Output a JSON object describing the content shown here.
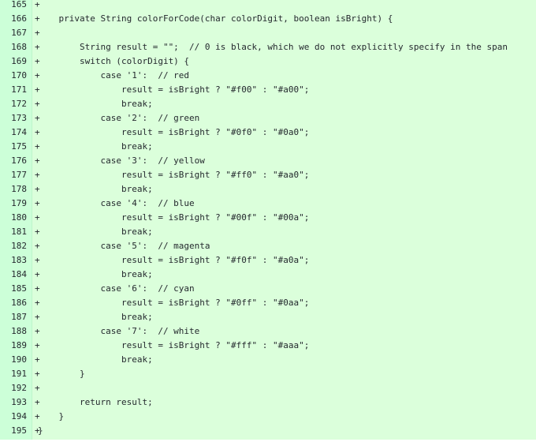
{
  "diff": {
    "lines": [
      {
        "num": "165",
        "sign": "+",
        "text": ""
      },
      {
        "num": "166",
        "sign": "+",
        "text": "    private String colorForCode(char colorDigit, boolean isBright) {"
      },
      {
        "num": "167",
        "sign": "+",
        "text": ""
      },
      {
        "num": "168",
        "sign": "+",
        "text": "        String result = \"\";  // 0 is black, which we do not explicitly specify in the span"
      },
      {
        "num": "169",
        "sign": "+",
        "text": "        switch (colorDigit) {"
      },
      {
        "num": "170",
        "sign": "+",
        "text": "            case '1':  // red"
      },
      {
        "num": "171",
        "sign": "+",
        "text": "                result = isBright ? \"#f00\" : \"#a00\";"
      },
      {
        "num": "172",
        "sign": "+",
        "text": "                break;"
      },
      {
        "num": "173",
        "sign": "+",
        "text": "            case '2':  // green"
      },
      {
        "num": "174",
        "sign": "+",
        "text": "                result = isBright ? \"#0f0\" : \"#0a0\";"
      },
      {
        "num": "175",
        "sign": "+",
        "text": "                break;"
      },
      {
        "num": "176",
        "sign": "+",
        "text": "            case '3':  // yellow"
      },
      {
        "num": "177",
        "sign": "+",
        "text": "                result = isBright ? \"#ff0\" : \"#aa0\";"
      },
      {
        "num": "178",
        "sign": "+",
        "text": "                break;"
      },
      {
        "num": "179",
        "sign": "+",
        "text": "            case '4':  // blue"
      },
      {
        "num": "180",
        "sign": "+",
        "text": "                result = isBright ? \"#00f\" : \"#00a\";"
      },
      {
        "num": "181",
        "sign": "+",
        "text": "                break;"
      },
      {
        "num": "182",
        "sign": "+",
        "text": "            case '5':  // magenta"
      },
      {
        "num": "183",
        "sign": "+",
        "text": "                result = isBright ? \"#f0f\" : \"#a0a\";"
      },
      {
        "num": "184",
        "sign": "+",
        "text": "                break;"
      },
      {
        "num": "185",
        "sign": "+",
        "text": "            case '6':  // cyan"
      },
      {
        "num": "186",
        "sign": "+",
        "text": "                result = isBright ? \"#0ff\" : \"#0aa\";"
      },
      {
        "num": "187",
        "sign": "+",
        "text": "                break;"
      },
      {
        "num": "188",
        "sign": "+",
        "text": "            case '7':  // white"
      },
      {
        "num": "189",
        "sign": "+",
        "text": "                result = isBright ? \"#fff\" : \"#aaa\";"
      },
      {
        "num": "190",
        "sign": "+",
        "text": "                break;"
      },
      {
        "num": "191",
        "sign": "+",
        "text": "        }"
      },
      {
        "num": "192",
        "sign": "+",
        "text": ""
      },
      {
        "num": "193",
        "sign": "+",
        "text": "        return result;"
      },
      {
        "num": "194",
        "sign": "+",
        "text": "    }"
      },
      {
        "num": "195",
        "sign": "+",
        "text": "}"
      }
    ]
  },
  "colors": {
    "added_background": "#dbffdb",
    "gutter_background": "#ccffd8",
    "text": "#24292e"
  }
}
